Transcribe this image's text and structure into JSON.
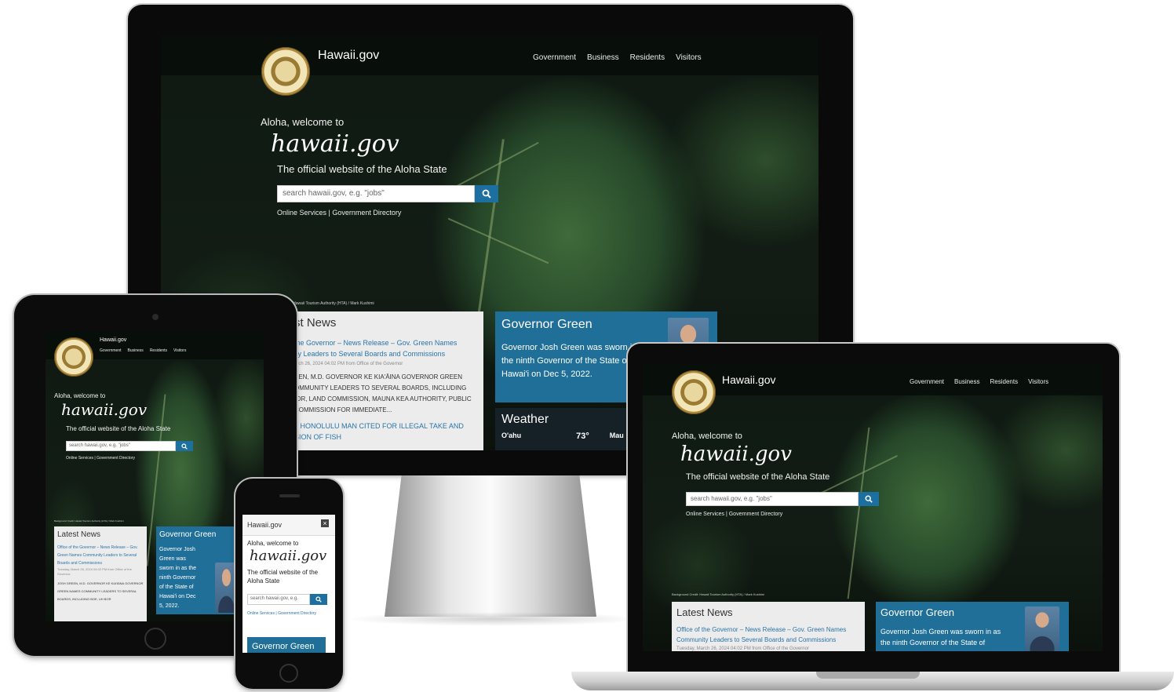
{
  "site": {
    "name": "Hawaii.gov",
    "nav": [
      "Government",
      "Business",
      "Residents",
      "Visitors"
    ],
    "welcome": "Aloha, welcome to",
    "script_logo": "hawaii.gov",
    "tagline": "The official website of the Aloha State",
    "search_placeholder": "search hawaii.gov, e.g. \"jobs\"",
    "search_placeholder_phone": "search hawaii.gov, e.g.",
    "links": "Online Services | Government Directory",
    "credit": "Background Credit: Hawaii Tourism Authority (HTA) / Mark Kushimi",
    "credit_cut": "t: Hawaii Tourism Authority (HTA) / Mark Kushimi"
  },
  "news": {
    "title": "Latest News",
    "title_cut": "st News",
    "item1_link": "Office of the Governor – News Release – Gov. Green Names Community Leaders to Several Boards and Commissions",
    "item1_link_monitor_a": "the Governor – News Release – Gov. Green Names",
    "item1_link_monitor_b": "ity Leaders to Several Boards and Commissions",
    "item1_date": "Tuesday, March 26, 2024 04:02 PM from Office of the Governor",
    "item1_date_cut": "arch 26, 2024 04:02 PM from Office of the Governor",
    "item1_body_a": "EEN, M.D. GOVERNOR KE KIA'ĀINA GOVERNOR GREEN",
    "item1_body_b": "OMMUNITY LEADERS TO SEVERAL BOARDS, INCLUDING",
    "item1_body_c": "IOR, LAND COMMISSION, MAUNA KEA AUTHORITY, PUBLIC",
    "item1_body_d": "COMMISSION    FOR IMMEDIATE...",
    "item1_body_tablet": "JOSH GREEN, M.D. GOVERNOR KE KIA'ĀINA GOVERNOR GREEN NAMES COMMUNITY LEADERS TO SEVERAL BOARDS, INCLUDING BOE, UH BOR",
    "item2_a": "– HONOLULU MAN CITED FOR ILLEGAL TAKE AND",
    "item2_b": "SION OF FISH",
    "laptop_link_a": "Office of the Governor – News Release – Gov. Green Names",
    "laptop_link_b": "Community Leaders to Several Boards and Commissions",
    "laptop_date": "Tuesday, March 26, 2024 04:02 PM from Office of the Governor"
  },
  "governor": {
    "title": "Governor Green",
    "text_monitor_a": "Governor Josh Green was sworn in",
    "text_monitor_b": "the ninth Governor of the State of",
    "text_monitor_c": "Hawai'i on Dec 5, 2022.",
    "text_tablet": "Governor Josh Green was sworn in as the ninth Governor of the State of Hawai'i on Dec 5, 2022.",
    "text_laptop_a": "Governor Josh Green was sworn in as",
    "text_laptop_b": "the ninth Governor of the State of"
  },
  "weather": {
    "title": "Weather",
    "island": "O'ahu",
    "temp": "73°",
    "island2": "Mau"
  },
  "phone": {
    "close": "×"
  },
  "colors": {
    "accent_blue": "#1f6f98",
    "search_blue": "#1d6fa0",
    "link_blue": "#2a74a8"
  }
}
